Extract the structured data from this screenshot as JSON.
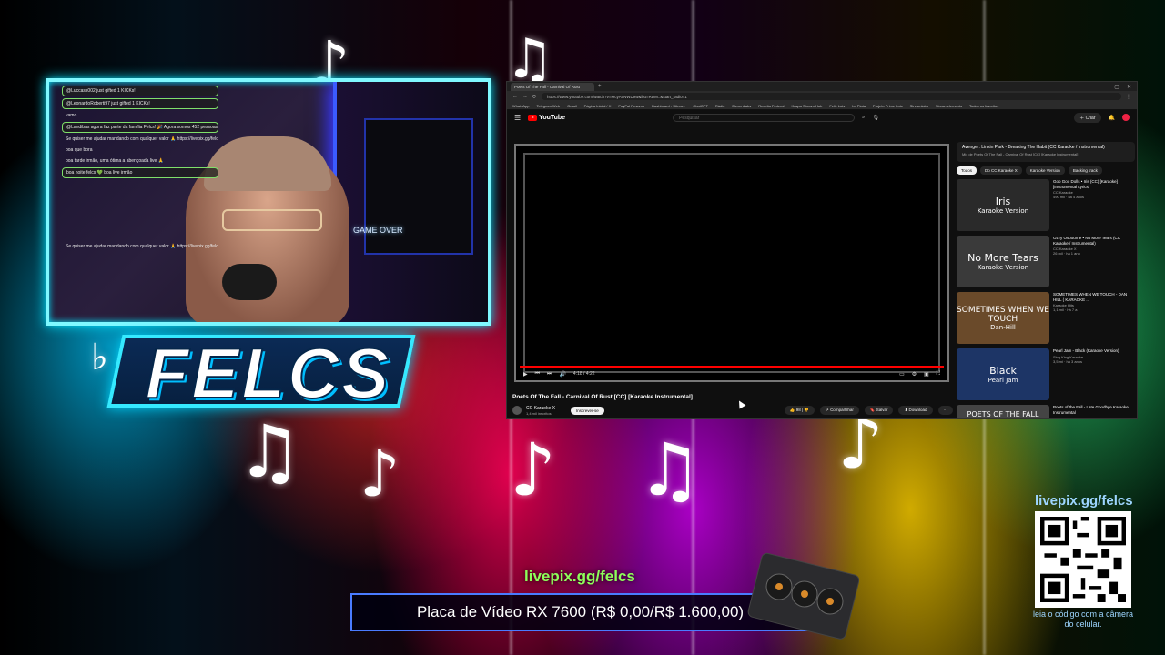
{
  "chat": {
    "lines": [
      "@Luccass002 just gifted 1 KICKs!",
      "@LeonardoRoberti97 just gifted 1 KICKs!",
      "vamo",
      "@Landibas agora faz parte da família Felcs! 🎉 Agora somos 452 pessoas nessa causa!",
      "Se quiser me ajudar mandando com qualquer valor 🙏 https://livepix.gg/felcs",
      "boa que bora",
      "boa tarde irmão, uma ótima a abençoada live 🙏",
      "boa noite felcs 💚 boa live irmão",
      "Se quiser me ajudar mandando com qualquer valor 🙏 https://livepix.gg/felcs"
    ]
  },
  "cam": {
    "sign": "GAME OVER"
  },
  "logo": {
    "text": "FELCS"
  },
  "browser": {
    "tab_title": "Poets Of The Fall - Carnival Of Rust",
    "url": "https://www.youtube.com/watch?v=McyAcNWD9w&list=RDM..&start_radio=1",
    "bookmarks": [
      "WhatsApp",
      "Telegram Web",
      "Gmail",
      "Página Inicial / X",
      "PayPal Resumo",
      "Dashboard - Sttrea...",
      "ChatGPT",
      "Rádio",
      "ElevenLabs",
      "Receita Federal",
      "Kaspa Stream Hub",
      "Feliz Luis",
      "La Plata",
      "Projeto Prime Luis",
      "Streamlabs",
      "Streamelements",
      "Todos os favoritos"
    ]
  },
  "youtube": {
    "logo_text": "YouTube",
    "search_placeholder": "Pesquisar",
    "create_label": "Criar",
    "video_title": "Poets Of The Fall - Carnival Of Rust [CC] [Karaoke Instrumental]",
    "time_display": "4:18 / 4:22",
    "channel_name": "CC Karaoke X",
    "channel_subs": "1,4 mil inscritos",
    "subscribe_label": "Inscrever-se",
    "likes": "98",
    "share_label": "Compartilhar",
    "save_label": "Salvar",
    "download_label": "Download",
    "more_label": "···",
    "playlist_title": "Avenger: Linkin Park - Breaking The Habit (CC Karaoke / Instrumental)",
    "playlist_sub": "Mix de Poets Of The Fall - Carnival Of Rust [CC] [Karaoke Instrumental]",
    "chips": [
      "Todos",
      "Do CC Karaoke X",
      "Karaoke Version",
      "Backing track"
    ],
    "recs": [
      {
        "thumb_1": "Iris",
        "thumb_2": "Karaoke Version",
        "title": "Goo Goo Dolls • Iris (CC) [Karaoke] [Instrumental Lyrics]",
        "channel": "CC Karaoke",
        "views": "490 mil · há 4 anos",
        "bg": "#2a2a2a"
      },
      {
        "thumb_1": "No More Tears",
        "thumb_2": "Karaoke Version",
        "title": "Ozzy Osbourne • No More Tears (CC Karaoke / Instrumental)",
        "channel": "CC Karaoke X",
        "views": "26 mil · há 1 ano",
        "bg": "#3a3a3a"
      },
      {
        "thumb_1": "SOMETIMES WHEN WE TOUCH",
        "thumb_2": "Dan-Hill",
        "title": "SOMETIMES WHEN WE TOUCH - DAN HILL ( KARAOKE ...",
        "channel": "Karaoke Hits",
        "views": "1,1 mil · há 7 a",
        "bg": "#6a4a2a"
      },
      {
        "thumb_1": "Black",
        "thumb_2": "Pearl Jam",
        "title": "Pearl Jam - Black (Karaoke Version)",
        "channel": "Sing King Karaoke",
        "views": "3,5 mi · há 3 anos",
        "bg": "#1d3566"
      },
      {
        "thumb_1": "POETS OF THE FALL",
        "thumb_2": "",
        "title": "Poets of the Fall - Late Goodbye Karaoke Instrumental",
        "channel": "",
        "views": "",
        "bg": "#444"
      }
    ]
  },
  "overlay": {
    "donate_link": "livepix.gg/felcs",
    "goal_text": "Placa de Vídeo RX 7600 (R$ 0,00/R$ 1.600,00)",
    "qr_title": "livepix.gg/felcs",
    "qr_caption": "leia o código com a câmera do celular."
  }
}
